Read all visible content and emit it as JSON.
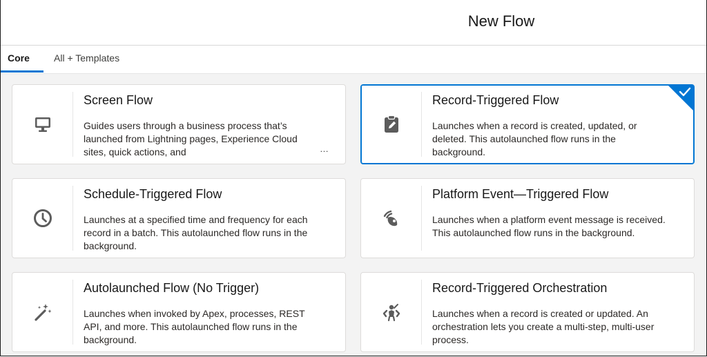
{
  "header": {
    "title": "New Flow"
  },
  "tabs": [
    {
      "label": "Core",
      "active": true
    },
    {
      "label": "All + Templates",
      "active": false
    }
  ],
  "colors": {
    "accent": "#0176d3",
    "icon": "#5c5c5c"
  },
  "cards": [
    {
      "icon": "desktop-icon",
      "title": "Screen Flow",
      "description": "Guides users through a business process that’s launched from Lightning pages, Experience Cloud sites, quick actions, and",
      "more": "…",
      "selected": false
    },
    {
      "icon": "clipboard-edit-icon",
      "title": "Record-Triggered Flow",
      "description": "Launches when a record is created, updated, or deleted. This autolaunched flow runs in the background.",
      "selected": true
    },
    {
      "icon": "clock-icon",
      "title": "Schedule-Triggered Flow",
      "description": "Launches at a specified time and frequency for each record in a batch. This autolaunched flow runs in the background.",
      "selected": false
    },
    {
      "icon": "platform-event-icon",
      "title": "Platform Event—Triggered Flow",
      "description": "Launches when a platform event message is received. This autolaunched flow runs in the background.",
      "selected": false
    },
    {
      "icon": "magic-wand-icon",
      "title": "Autolaunched Flow (No Trigger)",
      "description": "Launches when invoked by Apex, processes, REST API, and more. This autolaunched flow runs in the background.",
      "selected": false
    },
    {
      "icon": "orchestration-icon",
      "title": "Record-Triggered Orchestration",
      "description": "Launches when a record is created or updated. An orchestration lets you create a multi-step, multi-user process.",
      "selected": false
    }
  ]
}
